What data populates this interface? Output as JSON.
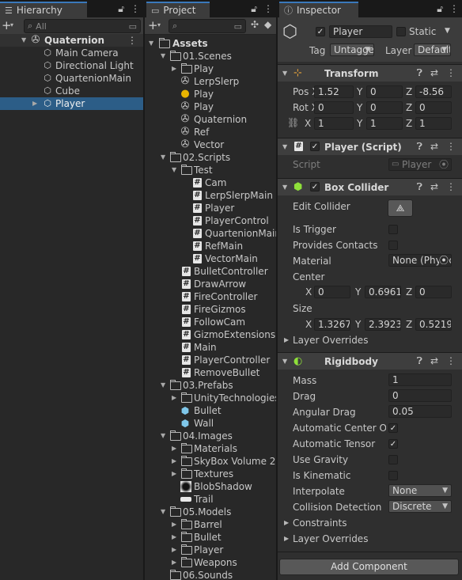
{
  "hierarchy": {
    "tab_label": "Hierarchy",
    "search_placeholder": "All",
    "scene_name": "Quaternion",
    "items": [
      "Main Camera",
      "Directional Light",
      "QuartenionMain",
      "Cube",
      "Player"
    ],
    "selected": "Player"
  },
  "project": {
    "tab_label": "Project",
    "root": "Assets",
    "folders": {
      "scenes": "01.Scenes",
      "scripts": "02.Scripts",
      "test": "Test",
      "prefabs": "03.Prefabs",
      "images": "04.Images",
      "models": "05.Models",
      "sounds": "06.Sounds"
    },
    "scene_items": [
      "Play",
      "LerpSlerp",
      "Play",
      "Play",
      "Quaternion",
      "Ref",
      "Vector"
    ],
    "test_scripts": [
      "Cam",
      "LerpSlerpMain",
      "Player",
      "PlayerControl",
      "QuartenionMain",
      "RefMain",
      "VectorMain"
    ],
    "scripts": [
      "BulletController",
      "DrawArrow",
      "FireController",
      "FireGizmos",
      "FollowCam",
      "GizmoExtensions",
      "Main",
      "PlayerController",
      "RemoveBullet"
    ],
    "prefab_items": [
      "UnityTechnologies",
      "Bullet",
      "Wall"
    ],
    "image_items": [
      "Materials",
      "SkyBox Volume 2",
      "Textures",
      "BlobShadow",
      "Trail"
    ],
    "model_items": [
      "Barrel",
      "Bullet",
      "Player",
      "Weapons"
    ]
  },
  "inspector": {
    "tab_label": "Inspector",
    "object_name": "Player",
    "static_label": "Static",
    "tag_label": "Tag",
    "tag_value": "Untagged",
    "layer_label": "Layer",
    "layer_value": "Default",
    "transform": {
      "title": "Transform",
      "pos_label": "Pos X",
      "rot_label": "Rot X",
      "scale_label": "X",
      "position": {
        "x": "1.52",
        "y": "0",
        "z": "-8.56"
      },
      "rotation": {
        "x": "0",
        "y": "0",
        "z": "0"
      },
      "scale": {
        "x": "1",
        "y": "1",
        "z": "1"
      }
    },
    "player_script": {
      "title": "Player (Script)",
      "script_label": "Script",
      "script_value": "Player"
    },
    "box_collider": {
      "title": "Box Collider",
      "edit_collider_label": "Edit Collider",
      "is_trigger_label": "Is Trigger",
      "provides_contacts_label": "Provides Contacts",
      "material_label": "Material",
      "material_value": "None (Physic Material)",
      "center_label": "Center",
      "center": {
        "x": "0",
        "y": "0.6961",
        "z": "0"
      },
      "size_label": "Size",
      "size": {
        "x": "1.3267",
        "y": "2.3923",
        "z": "0.5219"
      },
      "layer_overrides_label": "Layer Overrides"
    },
    "rigidbody": {
      "title": "Rigidbody",
      "mass_label": "Mass",
      "mass": "1",
      "drag_label": "Drag",
      "drag": "0",
      "angular_drag_label": "Angular Drag",
      "angular_drag": "0.05",
      "auto_com_label": "Automatic Center Of Mass",
      "auto_tensor_label": "Automatic Tensor",
      "use_gravity_label": "Use Gravity",
      "is_kinematic_label": "Is Kinematic",
      "interpolate_label": "Interpolate",
      "interpolate": "None",
      "collision_detection_label": "Collision Detection",
      "collision_detection": "Discrete",
      "constraints_label": "Constraints",
      "layer_overrides_label": "Layer Overrides"
    },
    "add_component_label": "Add Component"
  },
  "colors": {
    "accent": "#3a79bb",
    "selection": "#2c5d87",
    "panel": "#282828",
    "header": "#3e3e3e"
  }
}
